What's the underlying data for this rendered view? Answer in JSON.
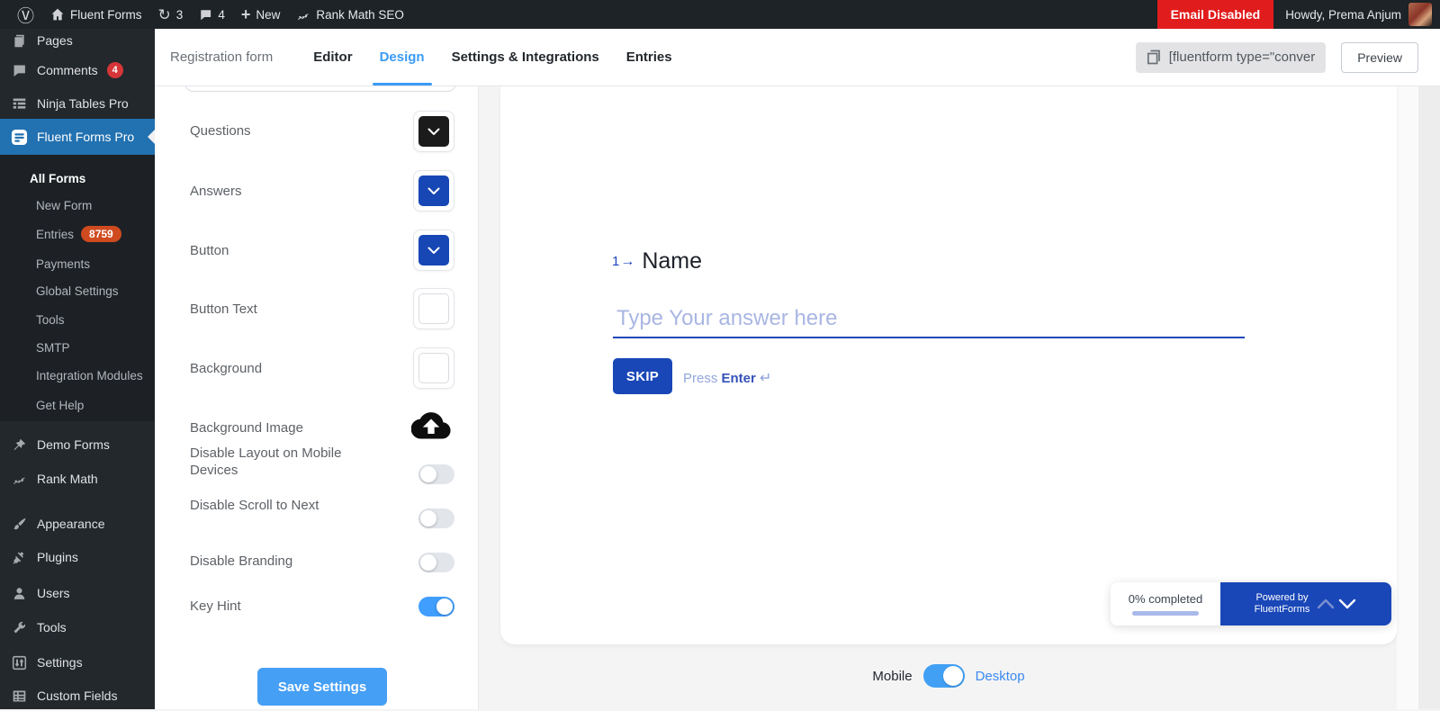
{
  "admin_bar": {
    "site_name": "Fluent Forms",
    "updates_count": "3",
    "comments_count": "4",
    "new_label": "New",
    "rank_math_label": "Rank Math SEO",
    "email_disabled_label": "Email Disabled",
    "howdy_label": "Howdy, Prema Anjum"
  },
  "sidebar": {
    "items": [
      {
        "label": "Pages"
      },
      {
        "label": "Comments",
        "badge": "4"
      },
      {
        "label": "Ninja Tables Pro"
      },
      {
        "label": "Fluent Forms Pro"
      }
    ],
    "submenu": [
      {
        "label": "All Forms"
      },
      {
        "label": "New Form"
      },
      {
        "label": "Entries",
        "badge": "8759"
      },
      {
        "label": "Payments"
      },
      {
        "label": "Global Settings"
      },
      {
        "label": "Tools"
      },
      {
        "label": "SMTP"
      },
      {
        "label": "Integration Modules"
      },
      {
        "label": "Get Help"
      }
    ],
    "plugin_items": [
      {
        "label": "Demo Forms"
      },
      {
        "label": "Rank Math"
      }
    ],
    "core_items": [
      {
        "label": "Appearance"
      },
      {
        "label": "Plugins"
      },
      {
        "label": "Users"
      },
      {
        "label": "Tools"
      },
      {
        "label": "Settings"
      },
      {
        "label": "Custom Fields"
      }
    ]
  },
  "header": {
    "form_name": "Registration form",
    "tabs": [
      {
        "label": "Editor"
      },
      {
        "label": "Design"
      },
      {
        "label": "Settings & Integrations"
      },
      {
        "label": "Entries"
      }
    ],
    "active_tab": "Design",
    "shortcode": "[fluentform type=\"conver",
    "preview_label": "Preview"
  },
  "design_panel": {
    "color_settings": [
      {
        "label": "Questions",
        "color": "#1b1b1b"
      },
      {
        "label": "Answers",
        "color": "#1747b5"
      },
      {
        "label": "Button",
        "color": "#1747b5"
      },
      {
        "label": "Button Text",
        "color": "#ffffff"
      },
      {
        "label": "Background",
        "color": "#ffffff"
      }
    ],
    "background_image_label": "Background Image",
    "toggles": [
      {
        "label": "Disable Layout on Mobile Devices",
        "on": false
      },
      {
        "label": "Disable Scroll to Next",
        "on": false
      },
      {
        "label": "Disable Branding",
        "on": false
      },
      {
        "label": "Key Hint",
        "on": true
      }
    ],
    "save_button_label": "Save Settings"
  },
  "preview": {
    "question_number": "1",
    "question_arrow": "→",
    "question_label": "Name",
    "answer_placeholder": "Type Your answer here",
    "skip_label": "SKIP",
    "press_label": "Press",
    "enter_label": "Enter",
    "enter_symbol": "↵",
    "progress_label": "0% completed",
    "powered_by_line1": "Powered by",
    "powered_by_line2": "FluentForms"
  },
  "footer": {
    "mobile_label": "Mobile",
    "desktop_label": "Desktop"
  },
  "colors": {
    "accent_blue": "#409eff",
    "form_blue": "#1947b8",
    "wp_admin_blue": "#2271b1",
    "email_disabled_red": "#e11c1c",
    "entries_badge_orange": "#cf4a1f",
    "comments_badge_red": "#d63638",
    "placeholder_blue": "#a9b6e2"
  }
}
